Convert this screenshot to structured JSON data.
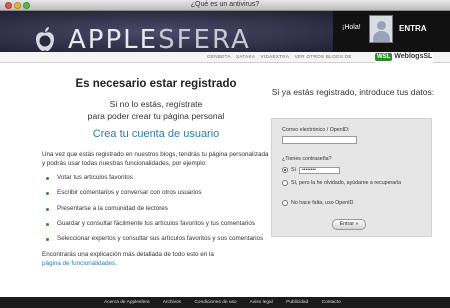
{
  "window": {
    "title": "¿Qué es un antivirus?"
  },
  "header": {
    "logo": {
      "part1": "APPLE",
      "part2": "SFERA"
    },
    "login": {
      "greeting": "¡Hola!",
      "enter_label": "ENTRA"
    },
    "subnav": [
      "GENBETA",
      "XATAKA",
      "VIDAEXTRA",
      "VER OTROS BLOGS DE"
    ],
    "weblogs": {
      "badge": "WSL",
      "text": "WeblogsSL"
    }
  },
  "left": {
    "title": "Es necesario estar registrado",
    "subtitle_line1": "Si no lo estás, regístrate",
    "subtitle_line2": "para poder crear tu página personal",
    "create_link": "Crea tu cuenta de usuario",
    "intro": "Una vez que estás registrado en nuestros blogs, tendrás tu página personalizada y podrás usar todas nuestras funcionalidades, por ejemplo:",
    "features": [
      "Votar tus artículos favoritos",
      "Escribir comentarios y conversar con otros usuarios",
      "Presentarse a la comunidad de lectores",
      "Guardar y consultar fácilmente tus artículos favoritos y tus comentarios",
      "Seleccionar expertos y consultar sus artículos favoritos y sus comentarios"
    ],
    "more_text": "Encontrarás una explicación más detallada de todo esto en la",
    "more_link": "página de funcionalidades"
  },
  "right": {
    "title": "Si ya estás registrado, introduce tus datos:",
    "email_label": "Correo electrónico / OpenID:",
    "email_value": "",
    "password_question": "¿Tienes contraseña?",
    "option_yes": "Sí",
    "password_value": "••••••••",
    "option_forgot": "Sí, pero la he olvidado, ayúdame a recuperarla",
    "option_openid": "No hace falta, uso OpenID",
    "submit_label": "Entrar »"
  },
  "footer": {
    "links": [
      "Acerca de Applesfera",
      "Archivos",
      "Condiciones de uso",
      "Aviso legal",
      "Publicidad",
      "Contacto"
    ]
  }
}
